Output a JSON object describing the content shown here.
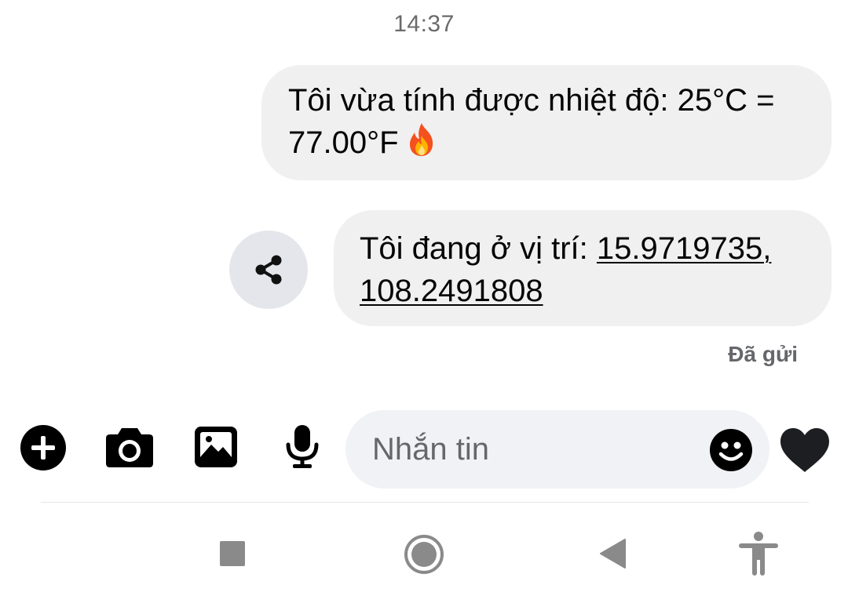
{
  "thread": {
    "timestamp": "14:37",
    "messages": [
      {
        "text": "Tôi vừa tính được nhiệt độ: 25°C = 77.00°F",
        "emoji": "fire-icon"
      },
      {
        "prefix": "Tôi đang ở vị trí: ",
        "location_text": "15.9719735, 108.2491808"
      }
    ],
    "status": "Đã gửi"
  },
  "composer": {
    "placeholder": "Nhắn tin",
    "icons": [
      "plus-icon",
      "camera-icon",
      "image-icon",
      "microphone-icon",
      "emoji-icon",
      "heart-icon"
    ]
  },
  "nav_bar": {
    "icons": [
      "recents-square-icon",
      "home-circle-icon",
      "back-triangle-icon",
      "accessibility-icon"
    ]
  },
  "colors": {
    "bubble": "#f0f0f0",
    "share_circle": "#e4e6eb",
    "icon_dark": "#000000",
    "heart": "#1c1e21",
    "status_text": "#65676b",
    "nav_gray": "#8a8a8a"
  }
}
